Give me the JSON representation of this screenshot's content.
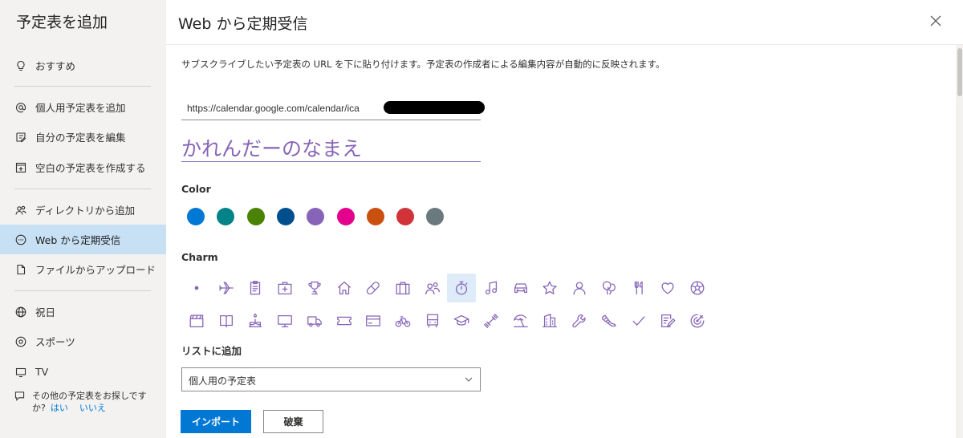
{
  "sidebar": {
    "title": "予定表を追加",
    "items": [
      {
        "label": "おすすめ",
        "icon": "lightbulb-icon"
      },
      {
        "label": "個人用予定表を追加",
        "icon": "at-icon"
      },
      {
        "label": "自分の予定表を編集",
        "icon": "edit-icon"
      },
      {
        "label": "空白の予定表を作成する",
        "icon": "add-calendar-icon"
      },
      {
        "label": "ディレクトリから追加",
        "icon": "people-icon"
      },
      {
        "label": "Web から定期受信",
        "icon": "more-circle-icon",
        "active": true
      },
      {
        "label": "ファイルからアップロード",
        "icon": "file-icon"
      },
      {
        "label": "祝日",
        "icon": "globe-icon"
      },
      {
        "label": "スポーツ",
        "icon": "ball-icon"
      },
      {
        "label": "TV",
        "icon": "tv-icon"
      }
    ],
    "footer": {
      "text_line1": "その他の予定表をお探しです",
      "text_line2": "か?",
      "yes": "はい",
      "no": "いいえ"
    }
  },
  "dialog": {
    "title": "Web から定期受信",
    "description": "サブスクライブしたい予定表の URL を下に貼り付けます。予定表の作成者による編集内容が自動的に反映されます。",
    "url_value": "https://calendar.google.com/calendar/ica",
    "name_value": "かれんだーのなまえ",
    "color_label": "Color",
    "colors": [
      "#0078d4",
      "#038387",
      "#498205",
      "#004e8c",
      "#8764b8",
      "#e3008c",
      "#ca5010",
      "#d13438",
      "#69797e"
    ],
    "charm_label": "Charm",
    "charms": [
      "dot",
      "airplane",
      "clipboard",
      "medical-bag",
      "trophy",
      "home",
      "pill",
      "briefcase",
      "people",
      "stopwatch",
      "music-note",
      "car",
      "star",
      "person",
      "balloons",
      "cutlery",
      "heart",
      "soccer-ball",
      "clapperboard",
      "book",
      "cake",
      "monitor",
      "truck",
      "ticket",
      "credit-card",
      "bicycle",
      "bus",
      "graduation-cap",
      "dumbbell",
      "beach-umbrella",
      "building",
      "wrench",
      "running-shoe",
      "checkmark",
      "notepad",
      "target"
    ],
    "selected_charm": "stopwatch",
    "list_label": "リストに追加",
    "list_value": "個人用の予定表",
    "import_button": "インポート",
    "discard_button": "破棄"
  }
}
